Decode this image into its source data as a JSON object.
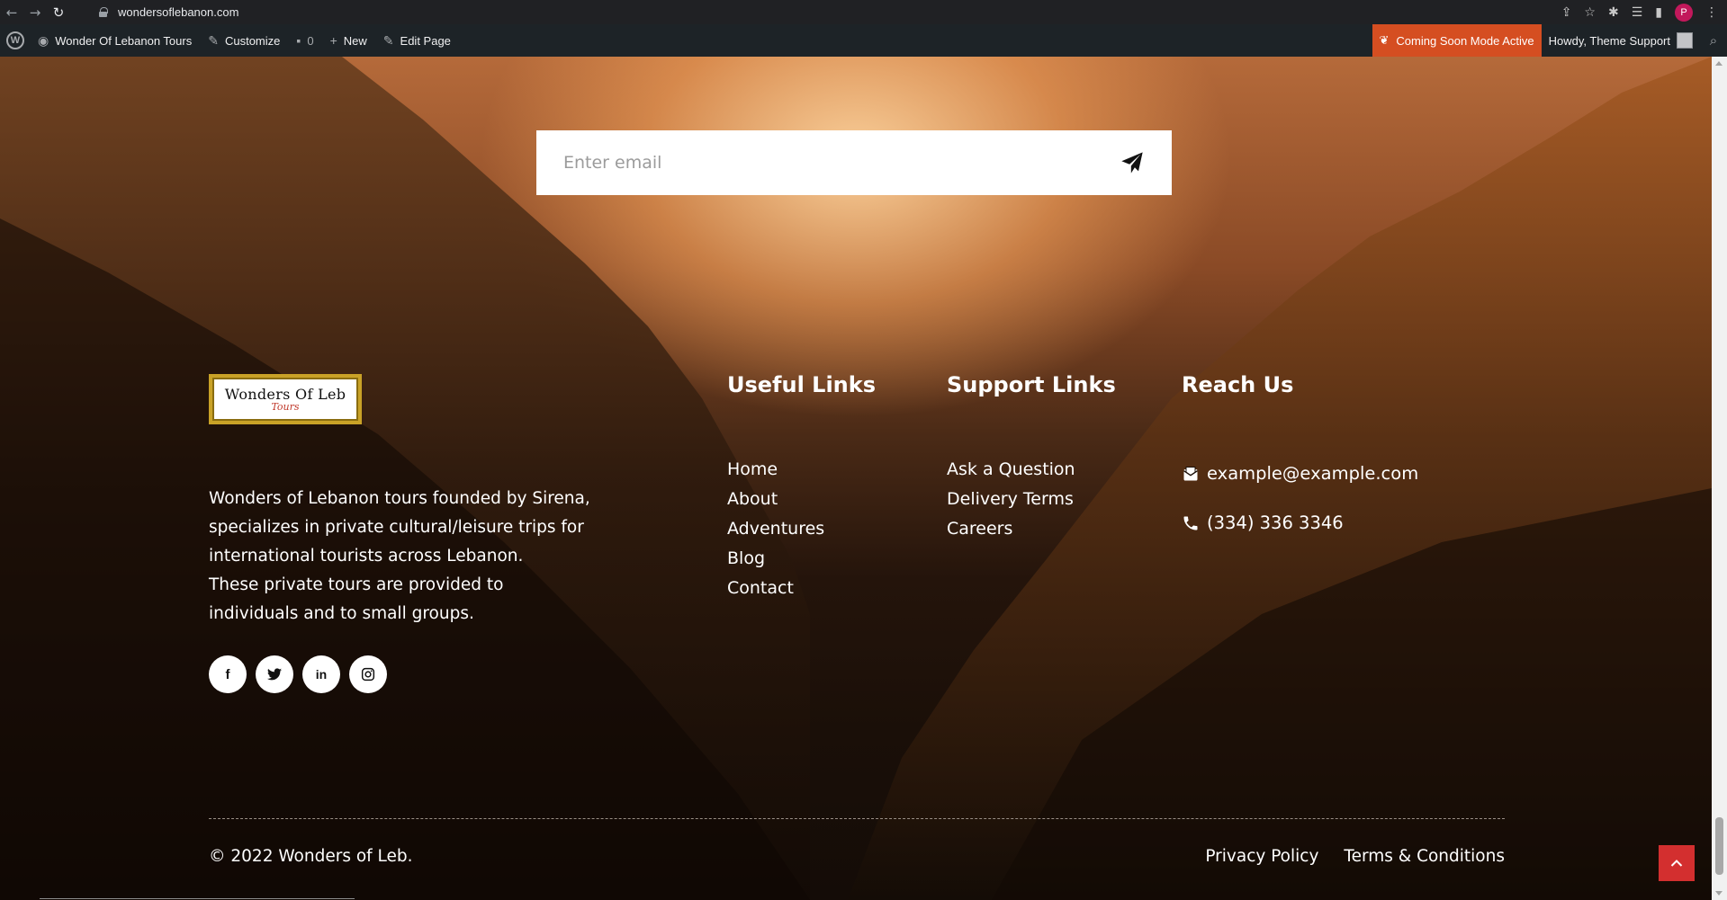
{
  "browser": {
    "url": "wondersoflebanon.com",
    "profile_initial": "P",
    "icons": [
      "back-icon",
      "forward-icon",
      "reload-icon",
      "lock-icon",
      "share-icon",
      "star-icon",
      "extensions-icon",
      "reading-list-icon",
      "side-panel-icon",
      "more-icon"
    ]
  },
  "admin_bar": {
    "site_name": "Wonder Of Lebanon Tours",
    "customize": "Customize",
    "comments_count": "0",
    "new": "New",
    "edit_page": "Edit Page",
    "coming_soon": "Coming Soon Mode Active",
    "howdy": "Howdy, Theme Support"
  },
  "newsletter": {
    "placeholder": "Enter email",
    "icon": "paper-plane-icon"
  },
  "logo": {
    "main": "Wonders Of Leb",
    "sub": "Tours"
  },
  "about": {
    "line1": "Wonders of Lebanon tours founded by Sirena, specializes in private cultural/leisure trips for international tourists across Lebanon.",
    "line2": "These private tours are provided to individuals and to small groups."
  },
  "socials": [
    {
      "icon": "facebook-icon",
      "glyph": "f"
    },
    {
      "icon": "twitter-icon",
      "glyph": "t"
    },
    {
      "icon": "linkedin-icon",
      "glyph": "in"
    },
    {
      "icon": "instagram-icon",
      "glyph": "◎"
    }
  ],
  "useful_links": {
    "title": "Useful Links",
    "items": [
      "Home",
      "About",
      "Adventures",
      "Blog",
      "Contact"
    ]
  },
  "support_links": {
    "title": "Support Links",
    "items": [
      "Ask a Question",
      "Delivery Terms",
      "Careers"
    ]
  },
  "reach_us": {
    "title": "Reach Us",
    "email": "example@example.com",
    "phone": "(334) 336 3346"
  },
  "bottom": {
    "copyright": "© 2022 Wonders of Leb.",
    "privacy": "Privacy Policy",
    "terms": "Terms & Conditions"
  },
  "colors": {
    "admin_bar": "#1d2327",
    "coming_soon": "#d54e21",
    "back_to_top": "#d32f2f",
    "logo_border": "#c9a227"
  }
}
